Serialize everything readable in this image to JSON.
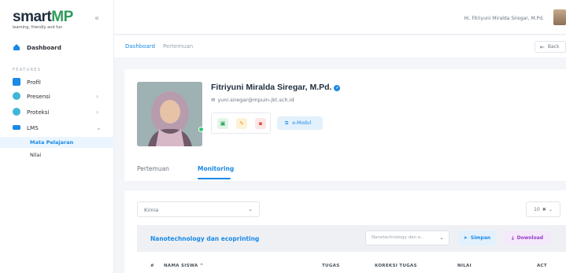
{
  "brand": {
    "logo_main": "smart",
    "logo_accent": "MP",
    "tagline": "learning, friendly and fun",
    "collapse_icon": "chevrons-left-icon"
  },
  "sidebar": {
    "dashboard_label": "Dashboard",
    "section_label": "FEATURES",
    "items": [
      {
        "label": "Profil",
        "icon": "user-icon",
        "color": "#1b89e6"
      },
      {
        "label": "Presensi",
        "icon": "fingerprint-icon",
        "color": "#3fb7d6"
      },
      {
        "label": "Proteksi",
        "icon": "shield-icon",
        "color": "#3fb7d6"
      },
      {
        "label": "LMS",
        "icon": "book-icon",
        "color": "#1b89e6"
      }
    ],
    "sub_items": [
      {
        "label": "Mata Pelajaran",
        "active": true
      },
      {
        "label": "Nilai",
        "active": false
      }
    ]
  },
  "topbar": {
    "greeting": "Hi,  Fitriyuni Miralda Siregar, M.Pd."
  },
  "breadcrumb": {
    "items": [
      "Dashboard",
      "Pertemuan"
    ],
    "back_label": "Back"
  },
  "profile": {
    "name": "Fitriyuni Miralda Siregar, M.Pd.",
    "email": "yuni.siregar@mpuin-jkt.sch.id",
    "emodul_label": "e-Modul",
    "tabs": [
      {
        "label": "Pertemuan",
        "active": false
      },
      {
        "label": "Monitoring",
        "active": true
      }
    ]
  },
  "monitoring": {
    "subject_value": "Kimia",
    "page_size": "10",
    "topic_title": "Nanotechnology dan ecoprinting",
    "topic_select_value": "Nanotechnology dan e...",
    "simpan_label": "Simpan",
    "download_label": "Download",
    "columns": [
      "#",
      "NAMA SISWA ^",
      "TUGAS",
      "KOREKSI TUGAS",
      "NILAI",
      "ACT"
    ]
  },
  "colors": {
    "primary": "#1b89e6",
    "brand_green": "#2d9c5a",
    "download_purple": "#9b3cc9",
    "online": "#2ecc71"
  }
}
